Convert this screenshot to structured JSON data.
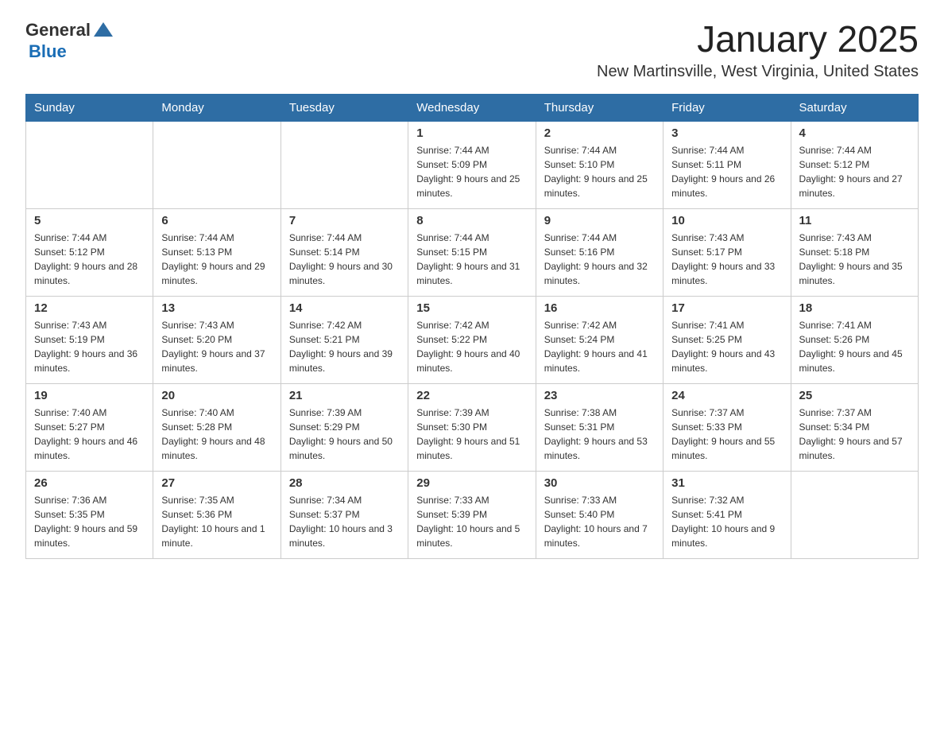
{
  "logo": {
    "text_general": "General",
    "text_blue": "Blue"
  },
  "header": {
    "month_year": "January 2025",
    "location": "New Martinsville, West Virginia, United States"
  },
  "days_of_week": [
    "Sunday",
    "Monday",
    "Tuesday",
    "Wednesday",
    "Thursday",
    "Friday",
    "Saturday"
  ],
  "weeks": [
    [
      {
        "day": "",
        "info": ""
      },
      {
        "day": "",
        "info": ""
      },
      {
        "day": "",
        "info": ""
      },
      {
        "day": "1",
        "info": "Sunrise: 7:44 AM\nSunset: 5:09 PM\nDaylight: 9 hours and 25 minutes."
      },
      {
        "day": "2",
        "info": "Sunrise: 7:44 AM\nSunset: 5:10 PM\nDaylight: 9 hours and 25 minutes."
      },
      {
        "day": "3",
        "info": "Sunrise: 7:44 AM\nSunset: 5:11 PM\nDaylight: 9 hours and 26 minutes."
      },
      {
        "day": "4",
        "info": "Sunrise: 7:44 AM\nSunset: 5:12 PM\nDaylight: 9 hours and 27 minutes."
      }
    ],
    [
      {
        "day": "5",
        "info": "Sunrise: 7:44 AM\nSunset: 5:12 PM\nDaylight: 9 hours and 28 minutes."
      },
      {
        "day": "6",
        "info": "Sunrise: 7:44 AM\nSunset: 5:13 PM\nDaylight: 9 hours and 29 minutes."
      },
      {
        "day": "7",
        "info": "Sunrise: 7:44 AM\nSunset: 5:14 PM\nDaylight: 9 hours and 30 minutes."
      },
      {
        "day": "8",
        "info": "Sunrise: 7:44 AM\nSunset: 5:15 PM\nDaylight: 9 hours and 31 minutes."
      },
      {
        "day": "9",
        "info": "Sunrise: 7:44 AM\nSunset: 5:16 PM\nDaylight: 9 hours and 32 minutes."
      },
      {
        "day": "10",
        "info": "Sunrise: 7:43 AM\nSunset: 5:17 PM\nDaylight: 9 hours and 33 minutes."
      },
      {
        "day": "11",
        "info": "Sunrise: 7:43 AM\nSunset: 5:18 PM\nDaylight: 9 hours and 35 minutes."
      }
    ],
    [
      {
        "day": "12",
        "info": "Sunrise: 7:43 AM\nSunset: 5:19 PM\nDaylight: 9 hours and 36 minutes."
      },
      {
        "day": "13",
        "info": "Sunrise: 7:43 AM\nSunset: 5:20 PM\nDaylight: 9 hours and 37 minutes."
      },
      {
        "day": "14",
        "info": "Sunrise: 7:42 AM\nSunset: 5:21 PM\nDaylight: 9 hours and 39 minutes."
      },
      {
        "day": "15",
        "info": "Sunrise: 7:42 AM\nSunset: 5:22 PM\nDaylight: 9 hours and 40 minutes."
      },
      {
        "day": "16",
        "info": "Sunrise: 7:42 AM\nSunset: 5:24 PM\nDaylight: 9 hours and 41 minutes."
      },
      {
        "day": "17",
        "info": "Sunrise: 7:41 AM\nSunset: 5:25 PM\nDaylight: 9 hours and 43 minutes."
      },
      {
        "day": "18",
        "info": "Sunrise: 7:41 AM\nSunset: 5:26 PM\nDaylight: 9 hours and 45 minutes."
      }
    ],
    [
      {
        "day": "19",
        "info": "Sunrise: 7:40 AM\nSunset: 5:27 PM\nDaylight: 9 hours and 46 minutes."
      },
      {
        "day": "20",
        "info": "Sunrise: 7:40 AM\nSunset: 5:28 PM\nDaylight: 9 hours and 48 minutes."
      },
      {
        "day": "21",
        "info": "Sunrise: 7:39 AM\nSunset: 5:29 PM\nDaylight: 9 hours and 50 minutes."
      },
      {
        "day": "22",
        "info": "Sunrise: 7:39 AM\nSunset: 5:30 PM\nDaylight: 9 hours and 51 minutes."
      },
      {
        "day": "23",
        "info": "Sunrise: 7:38 AM\nSunset: 5:31 PM\nDaylight: 9 hours and 53 minutes."
      },
      {
        "day": "24",
        "info": "Sunrise: 7:37 AM\nSunset: 5:33 PM\nDaylight: 9 hours and 55 minutes."
      },
      {
        "day": "25",
        "info": "Sunrise: 7:37 AM\nSunset: 5:34 PM\nDaylight: 9 hours and 57 minutes."
      }
    ],
    [
      {
        "day": "26",
        "info": "Sunrise: 7:36 AM\nSunset: 5:35 PM\nDaylight: 9 hours and 59 minutes."
      },
      {
        "day": "27",
        "info": "Sunrise: 7:35 AM\nSunset: 5:36 PM\nDaylight: 10 hours and 1 minute."
      },
      {
        "day": "28",
        "info": "Sunrise: 7:34 AM\nSunset: 5:37 PM\nDaylight: 10 hours and 3 minutes."
      },
      {
        "day": "29",
        "info": "Sunrise: 7:33 AM\nSunset: 5:39 PM\nDaylight: 10 hours and 5 minutes."
      },
      {
        "day": "30",
        "info": "Sunrise: 7:33 AM\nSunset: 5:40 PM\nDaylight: 10 hours and 7 minutes."
      },
      {
        "day": "31",
        "info": "Sunrise: 7:32 AM\nSunset: 5:41 PM\nDaylight: 10 hours and 9 minutes."
      },
      {
        "day": "",
        "info": ""
      }
    ]
  ]
}
